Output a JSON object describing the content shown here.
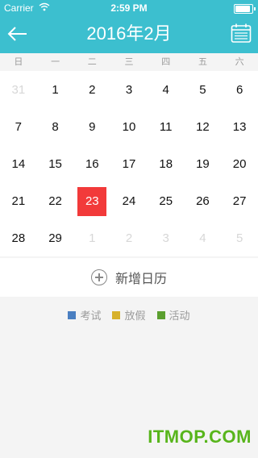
{
  "status_bar": {
    "carrier": "Carrier",
    "time": "2:59 PM"
  },
  "nav": {
    "title": "2016年2月",
    "back_icon": "arrow-left-icon",
    "calendar_icon": "calendar-icon"
  },
  "weekdays": [
    "日",
    "一",
    "二",
    "三",
    "四",
    "五",
    "六"
  ],
  "calendar": {
    "weeks": [
      [
        {
          "d": "31",
          "o": true
        },
        {
          "d": "1"
        },
        {
          "d": "2"
        },
        {
          "d": "3"
        },
        {
          "d": "4"
        },
        {
          "d": "5"
        },
        {
          "d": "6"
        }
      ],
      [
        {
          "d": "7"
        },
        {
          "d": "8"
        },
        {
          "d": "9"
        },
        {
          "d": "10"
        },
        {
          "d": "11"
        },
        {
          "d": "12"
        },
        {
          "d": "13"
        }
      ],
      [
        {
          "d": "14"
        },
        {
          "d": "15"
        },
        {
          "d": "16"
        },
        {
          "d": "17"
        },
        {
          "d": "18"
        },
        {
          "d": "19"
        },
        {
          "d": "20"
        }
      ],
      [
        {
          "d": "21"
        },
        {
          "d": "22"
        },
        {
          "d": "23",
          "today": true
        },
        {
          "d": "24"
        },
        {
          "d": "25"
        },
        {
          "d": "26"
        },
        {
          "d": "27"
        }
      ],
      [
        {
          "d": "28"
        },
        {
          "d": "29"
        },
        {
          "d": "1",
          "o": true
        },
        {
          "d": "2",
          "o": true
        },
        {
          "d": "3",
          "o": true
        },
        {
          "d": "4",
          "o": true
        },
        {
          "d": "5",
          "o": true
        }
      ]
    ],
    "today_color": "#f23a3a"
  },
  "add_button": {
    "label": "新增日历"
  },
  "legend": [
    {
      "label": "考试",
      "color": "#4a7fc1"
    },
    {
      "label": "放假",
      "color": "#d7b12c"
    },
    {
      "label": "活动",
      "color": "#5b9f2f"
    }
  ],
  "watermark": "ITMOP.COM",
  "colors": {
    "header": "#3cbfcf"
  }
}
